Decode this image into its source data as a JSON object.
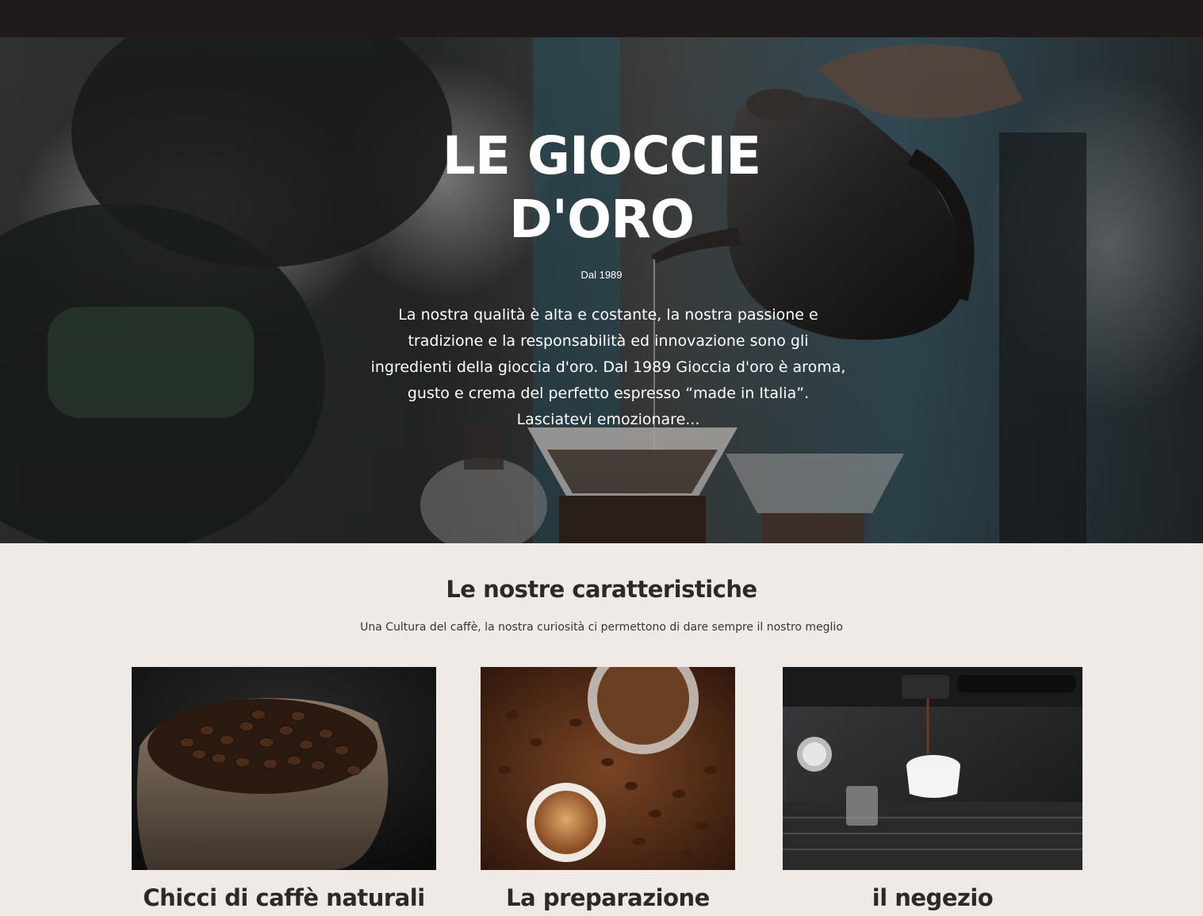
{
  "hero": {
    "title_line1": "LE GIOCCIE",
    "title_line2": "D'ORO",
    "since": "Dal 1989",
    "description": "La nostra qualità è alta e costante, la nostra passione e tradizione e la responsabilità ed innovazione sono gli ingredienti della gioccia d'oro. Dal 1989 Gioccia d'oro è aroma, gusto e crema del perfetto espresso “made in Italia”. Lasciatevi emozionare..."
  },
  "features": {
    "title": "Le nostre caratteristiche",
    "subtitle": "Una Cultura del caffè, la nostra curiosità ci permettono di dare sempre il nostro meglio",
    "cards": [
      {
        "title": "Chicci di caffè naturali",
        "image": "coffee-beans-sack-image"
      },
      {
        "title": "La preparazione",
        "image": "ground-coffee-and-espresso-image"
      },
      {
        "title": "il negezio",
        "image": "espresso-machine-image"
      }
    ]
  },
  "colors": {
    "topbar": "#1f1b1a",
    "page_background": "#efeae6",
    "heading_text": "#2f2926",
    "hero_text": "#ffffff"
  }
}
